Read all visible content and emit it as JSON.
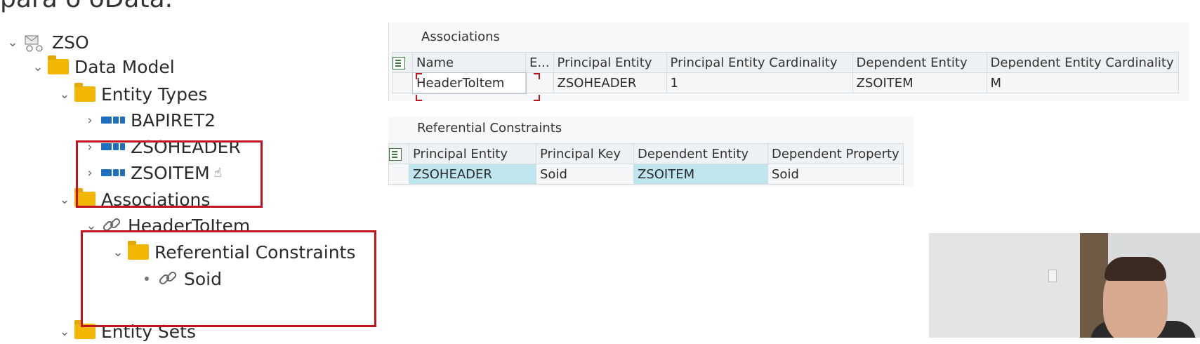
{
  "caption": "para o oData.",
  "tree": {
    "root": "ZSO",
    "data_model": "Data Model",
    "entity_types": "Entity Types",
    "entities": [
      "BAPIRET2",
      "ZSOHEADER",
      "ZSOITEM"
    ],
    "associations": "Associations",
    "association": "HeaderToItem",
    "referential_constraints": "Referential Constraints",
    "property": "Soid",
    "entity_sets": "Entity Sets"
  },
  "associations_panel": {
    "title": "Associations",
    "headers": [
      "Name",
      "E...",
      "Principal Entity",
      "Principal Entity Cardinality",
      "Dependent Entity",
      "Dependent Entity Cardinality"
    ],
    "row": [
      "HeaderToItem",
      "",
      "ZSOHEADER",
      "1",
      "ZSOITEM",
      "M"
    ]
  },
  "constraints_panel": {
    "title": "Referential Constraints",
    "headers": [
      "Principal Entity",
      "Principal Key",
      "Dependent Entity",
      "Dependent Property"
    ],
    "row": [
      "ZSOHEADER",
      "Soid",
      "ZSOITEM",
      "Soid"
    ]
  },
  "icons": {
    "folder": "folder-icon",
    "entity": "entity-type-icon",
    "link": "link-icon",
    "select": "select-all-icon"
  },
  "colors": {
    "folder": "#f2b705",
    "highlight": "#bfe6ef",
    "redbox": "#c0141f"
  }
}
